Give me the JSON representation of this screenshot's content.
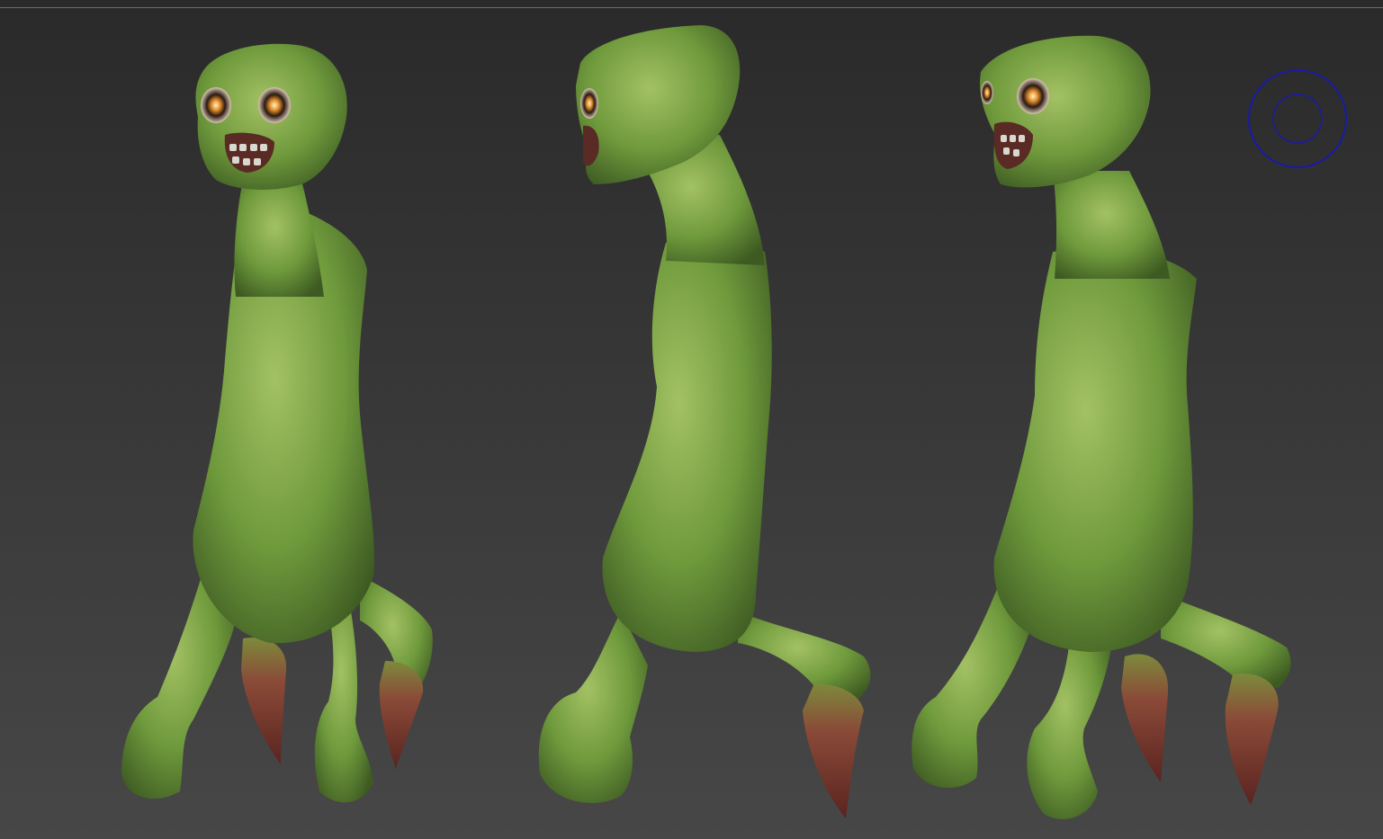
{
  "viewport": {
    "background_top": "#2a2a2a",
    "background_bottom": "#474747",
    "top_rule_color": "#6a6a6a"
  },
  "models": [
    {
      "name": "creature-view-front",
      "view": "front"
    },
    {
      "name": "creature-view-side",
      "view": "side"
    },
    {
      "name": "creature-view-three-quarter",
      "view": "three-quarter"
    }
  ],
  "colors": {
    "skin_green": "#6f9a3c",
    "skin_light": "#9dbb5c",
    "skin_dark": "#3d5a22",
    "claw_red": "#8a3a32",
    "gizmo_ring": "#1a1aa8"
  },
  "gizmo": {
    "icon": "rotation-gizmo-icon"
  }
}
